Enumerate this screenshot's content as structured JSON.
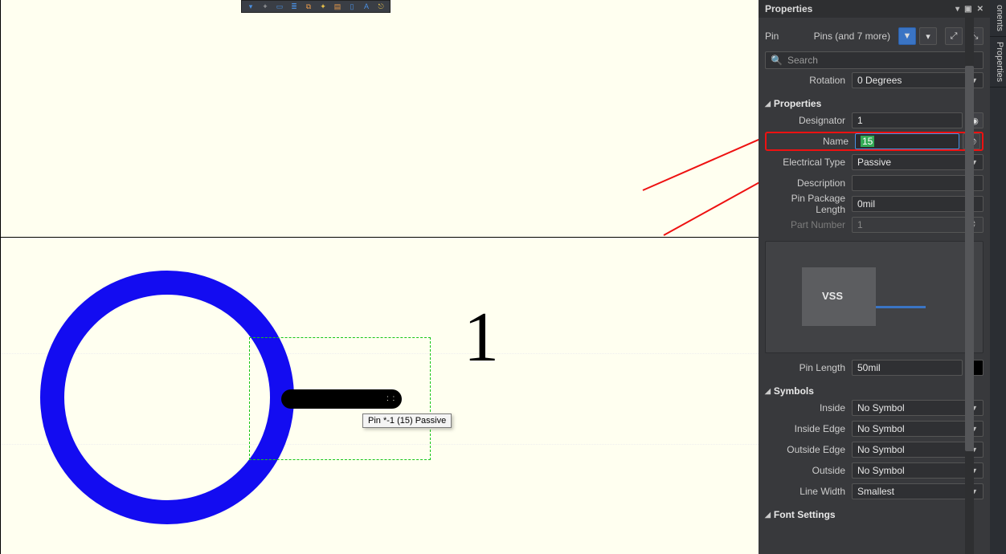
{
  "panel": {
    "title": "Properties",
    "object_label": "Pin",
    "selection_info": "Pins (and 7 more)",
    "search_placeholder": "Search",
    "rotation": {
      "label": "Rotation",
      "value": "0 Degrees"
    },
    "section_properties": "Properties",
    "designator": {
      "label": "Designator",
      "value": "1"
    },
    "name": {
      "label": "Name",
      "value": "15"
    },
    "electrical_type": {
      "label": "Electrical Type",
      "value": "Passive"
    },
    "description": {
      "label": "Description",
      "value": ""
    },
    "pin_pkg_len": {
      "label": "Pin Package Length",
      "value": "0mil"
    },
    "part_number": {
      "label": "Part Number",
      "value": "1"
    },
    "preview_name": "VSS",
    "pin_length": {
      "label": "Pin Length",
      "value": "50mil"
    },
    "section_symbols": "Symbols",
    "sym_inside": {
      "label": "Inside",
      "value": "No Symbol"
    },
    "sym_inside_edge": {
      "label": "Inside Edge",
      "value": "No Symbol"
    },
    "sym_outside_edge": {
      "label": "Outside Edge",
      "value": "No Symbol"
    },
    "sym_outside": {
      "label": "Outside",
      "value": "No Symbol"
    },
    "line_width": {
      "label": "Line Width",
      "value": "Smallest"
    },
    "section_font": "Font Settings"
  },
  "side_tabs": {
    "components": "onents",
    "properties": "Properties"
  },
  "canvas": {
    "designator_glyph": "1",
    "tooltip": "Pin *-1 (15) Passive"
  }
}
